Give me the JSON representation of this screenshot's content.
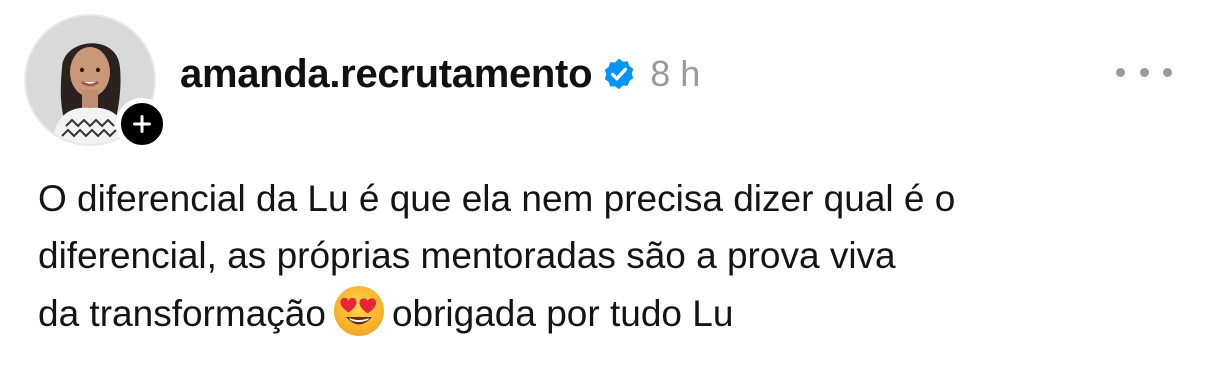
{
  "post": {
    "author": {
      "username": "amanda.recrutamento",
      "verified": true,
      "avatar_icon": "profile-photo",
      "follow_icon": "plus-icon"
    },
    "time_ago": "8 h",
    "more_icon": "ellipsis-icon",
    "text": {
      "line1": "O diferencial da Lu é que ela nem precisa dizer qual é o",
      "line2": "diferencial, as próprias mentoradas são a prova viva",
      "line3_before_emoji": "da transformação",
      "emoji": "heart-eyes-emoji",
      "line3_after_emoji": "obrigada por tudo Lu"
    },
    "colors": {
      "verified_blue": "#0095f6",
      "muted_gray": "#9a9a9a",
      "text": "#141414"
    }
  }
}
